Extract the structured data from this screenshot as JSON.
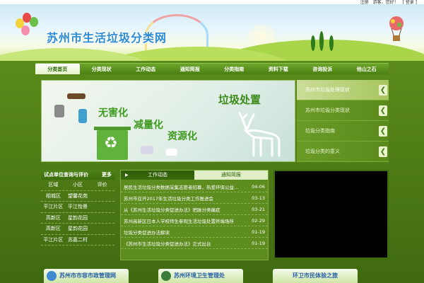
{
  "topbar": {
    "links": [
      "注册",
      "游客，您好！",
      "[ 登录 ]"
    ]
  },
  "header": {
    "title": "苏州市生活垃圾分类网"
  },
  "nav": {
    "items": [
      "分类首页",
      "分类现状",
      "工作动态",
      "通知简报",
      "分类指南",
      "资料下载",
      "咨询投诉",
      "他山之石"
    ],
    "active_index": 0
  },
  "banner": {
    "title": "垃圾处置",
    "slogans": [
      "无害化",
      "减量化",
      "资源化"
    ]
  },
  "sidemenu": {
    "items": [
      "苏州市垃圾处理现状",
      "苏州市垃圾分类现状",
      "垃圾分类指南",
      "垃圾分类的意义"
    ],
    "chevron_icon": "chevron-right-icon"
  },
  "left_panel": {
    "title": "试点单位查询与评价",
    "more": "更多",
    "columns": [
      "区域",
      "小区",
      "评价"
    ],
    "rows": [
      [
        "相城区",
        "望馨花苑",
        ""
      ],
      [
        "平江片区",
        "平江怡景",
        ""
      ],
      [
        "高新区",
        "星韵花园",
        ""
      ],
      [
        "高新区",
        "星韵花园",
        ""
      ],
      [
        "平江片区",
        "苏嘉二村",
        ""
      ]
    ]
  },
  "news_panel": {
    "tabs": [
      "工作动态",
      "通知简报"
    ],
    "active_tab": 0,
    "items": [
      {
        "title": "居民生活垃圾分类数据采集志愿者招募，热爱环保公益…",
        "date": "04-06"
      },
      {
        "title": "苏州市召开2017年生活垃圾分类工作推进会",
        "date": "03-13"
      },
      {
        "title": "从《苏州生活垃圾分类促进办法》把脉分类痛症",
        "date": "03-21"
      },
      {
        "title": "苏州高新区日本人学校师生参观生活垃圾处置终端场所",
        "date": "02-29"
      },
      {
        "title": "垃圾分类促进办法解读",
        "date": "01-19"
      },
      {
        "title": "《苏州市生活垃圾分类促进办法》正式出台",
        "date": "01-19"
      }
    ]
  },
  "footer_links": [
    "苏州市市容市政管理网",
    "苏州环境卫生管理处",
    "环卫市民体验之旅"
  ],
  "colors": {
    "accent": "#4e8317",
    "title_blue": "#2b8bd6"
  }
}
